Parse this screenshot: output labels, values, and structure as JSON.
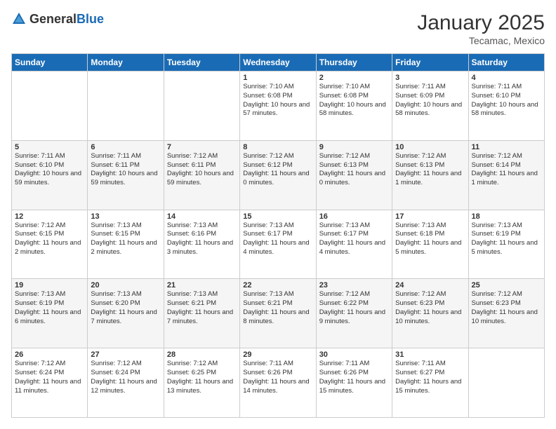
{
  "header": {
    "logo": {
      "general": "General",
      "blue": "Blue"
    },
    "title": "January 2025",
    "subtitle": "Tecamac, Mexico"
  },
  "days_of_week": [
    "Sunday",
    "Monday",
    "Tuesday",
    "Wednesday",
    "Thursday",
    "Friday",
    "Saturday"
  ],
  "weeks": [
    [
      {
        "day": "",
        "info": ""
      },
      {
        "day": "",
        "info": ""
      },
      {
        "day": "",
        "info": ""
      },
      {
        "day": "1",
        "info": "Sunrise: 7:10 AM\nSunset: 6:08 PM\nDaylight: 10 hours and 57 minutes."
      },
      {
        "day": "2",
        "info": "Sunrise: 7:10 AM\nSunset: 6:08 PM\nDaylight: 10 hours and 58 minutes."
      },
      {
        "day": "3",
        "info": "Sunrise: 7:11 AM\nSunset: 6:09 PM\nDaylight: 10 hours and 58 minutes."
      },
      {
        "day": "4",
        "info": "Sunrise: 7:11 AM\nSunset: 6:10 PM\nDaylight: 10 hours and 58 minutes."
      }
    ],
    [
      {
        "day": "5",
        "info": "Sunrise: 7:11 AM\nSunset: 6:10 PM\nDaylight: 10 hours and 59 minutes."
      },
      {
        "day": "6",
        "info": "Sunrise: 7:11 AM\nSunset: 6:11 PM\nDaylight: 10 hours and 59 minutes."
      },
      {
        "day": "7",
        "info": "Sunrise: 7:12 AM\nSunset: 6:11 PM\nDaylight: 10 hours and 59 minutes."
      },
      {
        "day": "8",
        "info": "Sunrise: 7:12 AM\nSunset: 6:12 PM\nDaylight: 11 hours and 0 minutes."
      },
      {
        "day": "9",
        "info": "Sunrise: 7:12 AM\nSunset: 6:13 PM\nDaylight: 11 hours and 0 minutes."
      },
      {
        "day": "10",
        "info": "Sunrise: 7:12 AM\nSunset: 6:13 PM\nDaylight: 11 hours and 1 minute."
      },
      {
        "day": "11",
        "info": "Sunrise: 7:12 AM\nSunset: 6:14 PM\nDaylight: 11 hours and 1 minute."
      }
    ],
    [
      {
        "day": "12",
        "info": "Sunrise: 7:12 AM\nSunset: 6:15 PM\nDaylight: 11 hours and 2 minutes."
      },
      {
        "day": "13",
        "info": "Sunrise: 7:13 AM\nSunset: 6:15 PM\nDaylight: 11 hours and 2 minutes."
      },
      {
        "day": "14",
        "info": "Sunrise: 7:13 AM\nSunset: 6:16 PM\nDaylight: 11 hours and 3 minutes."
      },
      {
        "day": "15",
        "info": "Sunrise: 7:13 AM\nSunset: 6:17 PM\nDaylight: 11 hours and 4 minutes."
      },
      {
        "day": "16",
        "info": "Sunrise: 7:13 AM\nSunset: 6:17 PM\nDaylight: 11 hours and 4 minutes."
      },
      {
        "day": "17",
        "info": "Sunrise: 7:13 AM\nSunset: 6:18 PM\nDaylight: 11 hours and 5 minutes."
      },
      {
        "day": "18",
        "info": "Sunrise: 7:13 AM\nSunset: 6:19 PM\nDaylight: 11 hours and 5 minutes."
      }
    ],
    [
      {
        "day": "19",
        "info": "Sunrise: 7:13 AM\nSunset: 6:19 PM\nDaylight: 11 hours and 6 minutes."
      },
      {
        "day": "20",
        "info": "Sunrise: 7:13 AM\nSunset: 6:20 PM\nDaylight: 11 hours and 7 minutes."
      },
      {
        "day": "21",
        "info": "Sunrise: 7:13 AM\nSunset: 6:21 PM\nDaylight: 11 hours and 7 minutes."
      },
      {
        "day": "22",
        "info": "Sunrise: 7:13 AM\nSunset: 6:21 PM\nDaylight: 11 hours and 8 minutes."
      },
      {
        "day": "23",
        "info": "Sunrise: 7:12 AM\nSunset: 6:22 PM\nDaylight: 11 hours and 9 minutes."
      },
      {
        "day": "24",
        "info": "Sunrise: 7:12 AM\nSunset: 6:23 PM\nDaylight: 11 hours and 10 minutes."
      },
      {
        "day": "25",
        "info": "Sunrise: 7:12 AM\nSunset: 6:23 PM\nDaylight: 11 hours and 10 minutes."
      }
    ],
    [
      {
        "day": "26",
        "info": "Sunrise: 7:12 AM\nSunset: 6:24 PM\nDaylight: 11 hours and 11 minutes."
      },
      {
        "day": "27",
        "info": "Sunrise: 7:12 AM\nSunset: 6:24 PM\nDaylight: 11 hours and 12 minutes."
      },
      {
        "day": "28",
        "info": "Sunrise: 7:12 AM\nSunset: 6:25 PM\nDaylight: 11 hours and 13 minutes."
      },
      {
        "day": "29",
        "info": "Sunrise: 7:11 AM\nSunset: 6:26 PM\nDaylight: 11 hours and 14 minutes."
      },
      {
        "day": "30",
        "info": "Sunrise: 7:11 AM\nSunset: 6:26 PM\nDaylight: 11 hours and 15 minutes."
      },
      {
        "day": "31",
        "info": "Sunrise: 7:11 AM\nSunset: 6:27 PM\nDaylight: 11 hours and 15 minutes."
      },
      {
        "day": "",
        "info": ""
      }
    ]
  ]
}
